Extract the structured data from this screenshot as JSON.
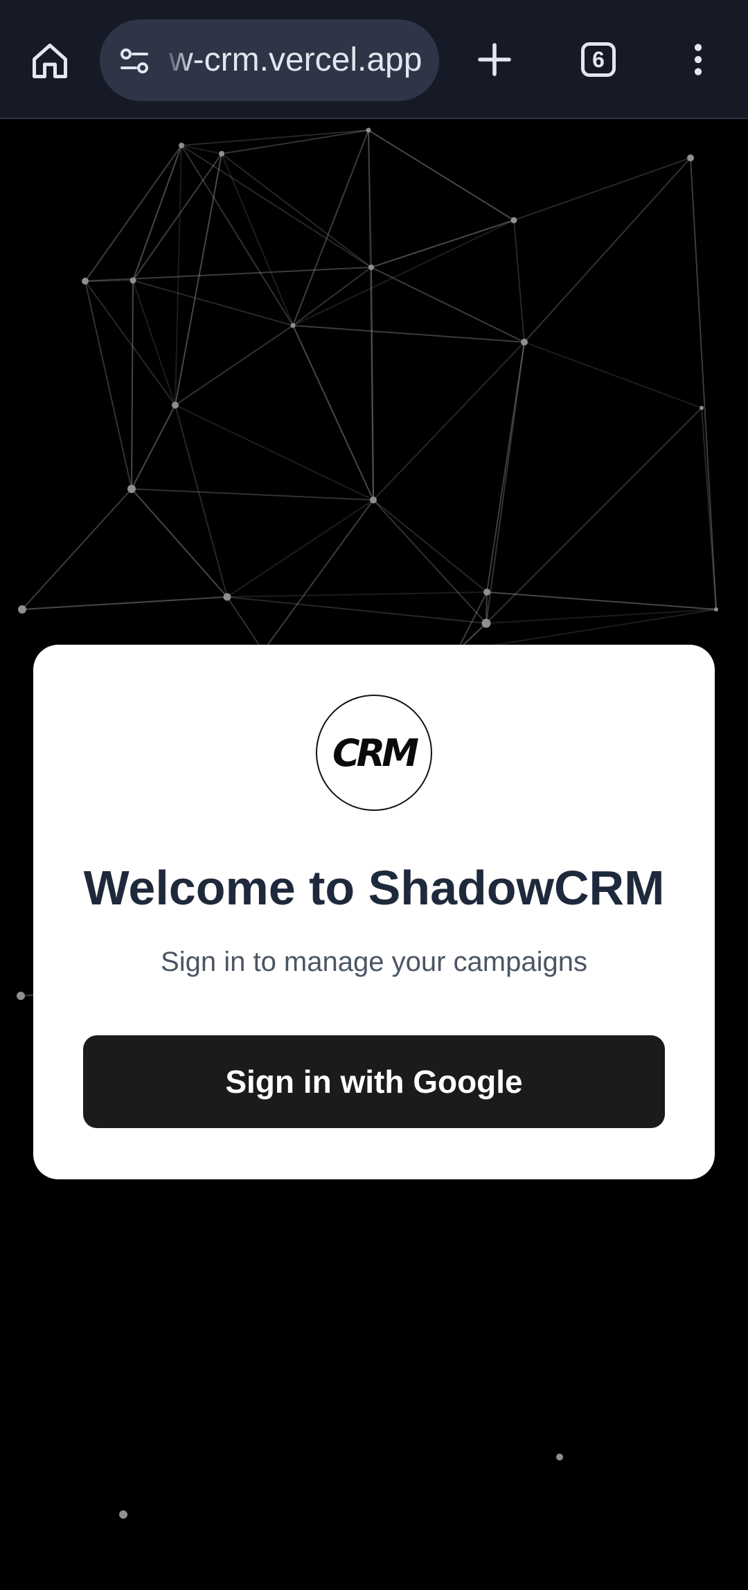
{
  "browser": {
    "url_text": "w-crm.vercel.app",
    "tab_count": "6",
    "icons": {
      "home": "home-icon",
      "site_settings": "site-settings-icon",
      "new_tab": "plus-icon",
      "tabs": "tab-switcher-icon",
      "menu": "more-vert-icon"
    }
  },
  "login": {
    "logo_text": "CRM",
    "title": "Welcome to ShadowCRM",
    "subtitle": "Sign in to manage your campaigns",
    "signin_button_label": "Sign in with Google"
  },
  "colors": {
    "page_background": "#000000",
    "browser_bar": "#151a26",
    "url_pill": "#2f3547",
    "card": "#ffffff",
    "title_text": "#1e293b",
    "subtitle_text": "#4b5563",
    "button": "#1b1b1b",
    "network_lines": "#9a9a9a"
  }
}
